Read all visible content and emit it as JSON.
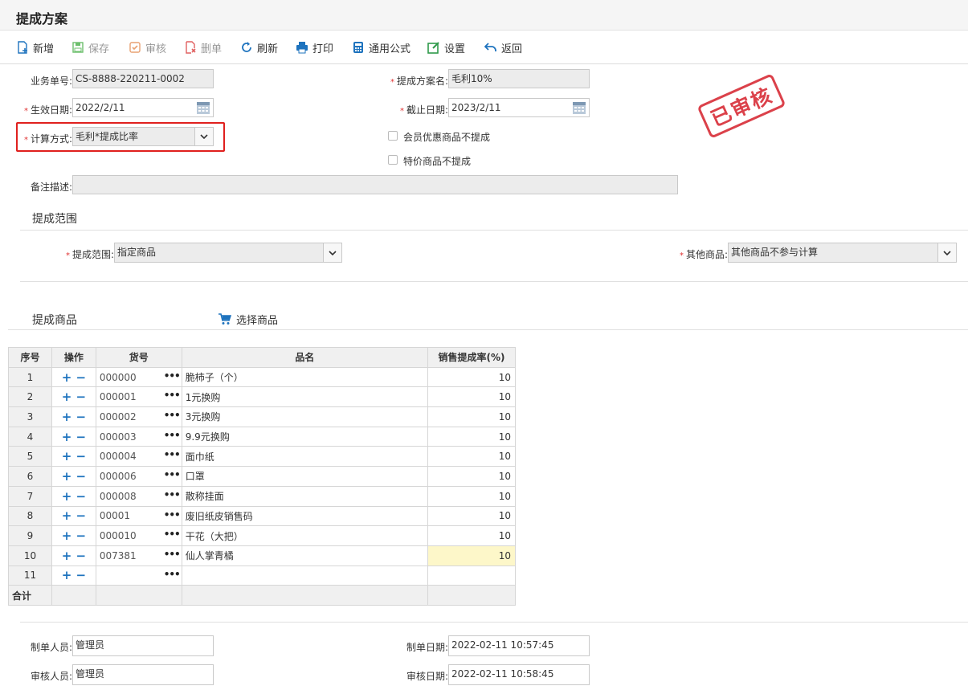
{
  "page": {
    "title": "提成方案"
  },
  "toolbar": {
    "add": "新增",
    "save": "保存",
    "audit": "审核",
    "delete": "删单",
    "refresh": "刷新",
    "print": "打印",
    "formula": "通用公式",
    "settings": "设置",
    "back": "返回"
  },
  "form": {
    "biz_no_label": "业务单号:",
    "biz_no": "CS-8888-220211-0002",
    "plan_name_label": "提成方案名:",
    "plan_name": "毛利10%",
    "effective_label": "生效日期:",
    "effective": "2022/2/11",
    "deadline_label": "截止日期:",
    "deadline": "2023/2/11",
    "calc_label": "计算方式:",
    "calc": "毛利*提成比率",
    "member_no_comm": "会员优惠商品不提成",
    "special_no_comm": "特价商品不提成",
    "remark_label": "备注描述:",
    "remark": ""
  },
  "stamp": "已审核",
  "scope": {
    "section_title": "提成范围",
    "scope_label": "提成范围:",
    "scope_value": "指定商品",
    "other_label": "其他商品:",
    "other_value": "其他商品不参与计算"
  },
  "goods": {
    "section_title": "提成商品",
    "select_label": "选择商品",
    "columns": {
      "no": "序号",
      "ops": "操作",
      "code": "货号",
      "name": "品名",
      "rate": "销售提成率(%)"
    },
    "rows": [
      {
        "no": "1",
        "code": "000000",
        "name": "脆柿子（个）",
        "rate": "10"
      },
      {
        "no": "2",
        "code": "000001",
        "name": "1元换购",
        "rate": "10"
      },
      {
        "no": "3",
        "code": "000002",
        "name": "3元换购",
        "rate": "10"
      },
      {
        "no": "4",
        "code": "000003",
        "name": "9.9元换购",
        "rate": "10"
      },
      {
        "no": "5",
        "code": "000004",
        "name": "面巾纸",
        "rate": "10"
      },
      {
        "no": "6",
        "code": "000006",
        "name": "口罩",
        "rate": "10"
      },
      {
        "no": "7",
        "code": "000008",
        "name": "散称挂面",
        "rate": "10"
      },
      {
        "no": "8",
        "code": "00001",
        "name": "废旧纸皮销售码",
        "rate": "10"
      },
      {
        "no": "9",
        "code": "000010",
        "name": "干花（大把）",
        "rate": "10"
      },
      {
        "no": "10",
        "code": "007381",
        "name": "仙人掌青橘",
        "rate": "10"
      },
      {
        "no": "11",
        "code": "",
        "name": "",
        "rate": ""
      }
    ],
    "total_label": "合计",
    "ops_plus": "+",
    "ops_minus": "−",
    "more": "•••"
  },
  "footer": {
    "creator_label": "制单人员:",
    "creator": "管理员",
    "create_date_label": "制单日期:",
    "create_date": "2022-02-11 10:57:45",
    "auditor_label": "审核人员:",
    "auditor": "管理员",
    "audit_date_label": "审核日期:",
    "audit_date": "2022-02-11 10:58:45"
  },
  "required_mark": "*",
  "colors": {
    "accent_blue": "#1e73be",
    "stamp_red": "#d9313b",
    "highlight_red": "#e0201e",
    "edit_cell": "#fdf7c9"
  }
}
